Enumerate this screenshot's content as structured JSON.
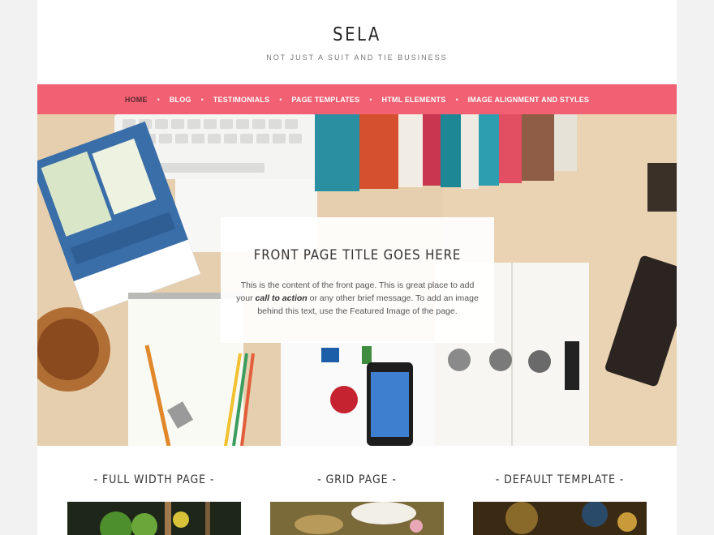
{
  "site": {
    "title": "SELA",
    "tagline": "NOT JUST A SUIT AND TIE BUSINESS"
  },
  "nav": {
    "items": [
      "HOME",
      "BLOG",
      "TESTIMONIALS",
      "PAGE TEMPLATES",
      "HTML ELEMENTS",
      "IMAGE ALIGNMENT AND STYLES"
    ],
    "separator": "•",
    "active_index": 0
  },
  "hero": {
    "title": "FRONT PAGE TITLE GOES HERE",
    "text_before": "This is the content of the front page. This is great place to add your ",
    "text_em": "call to action",
    "text_after": " or any other brief message. To add an image behind this text, use the Featured Image of the page."
  },
  "sections": [
    {
      "title": "- FULL WIDTH PAGE -"
    },
    {
      "title": "- GRID PAGE -"
    },
    {
      "title": "- DEFAULT TEMPLATE -"
    }
  ],
  "colors": {
    "nav_background": "#f16073",
    "nav_active": "#5a2a32",
    "page_background": "#ffffff"
  }
}
